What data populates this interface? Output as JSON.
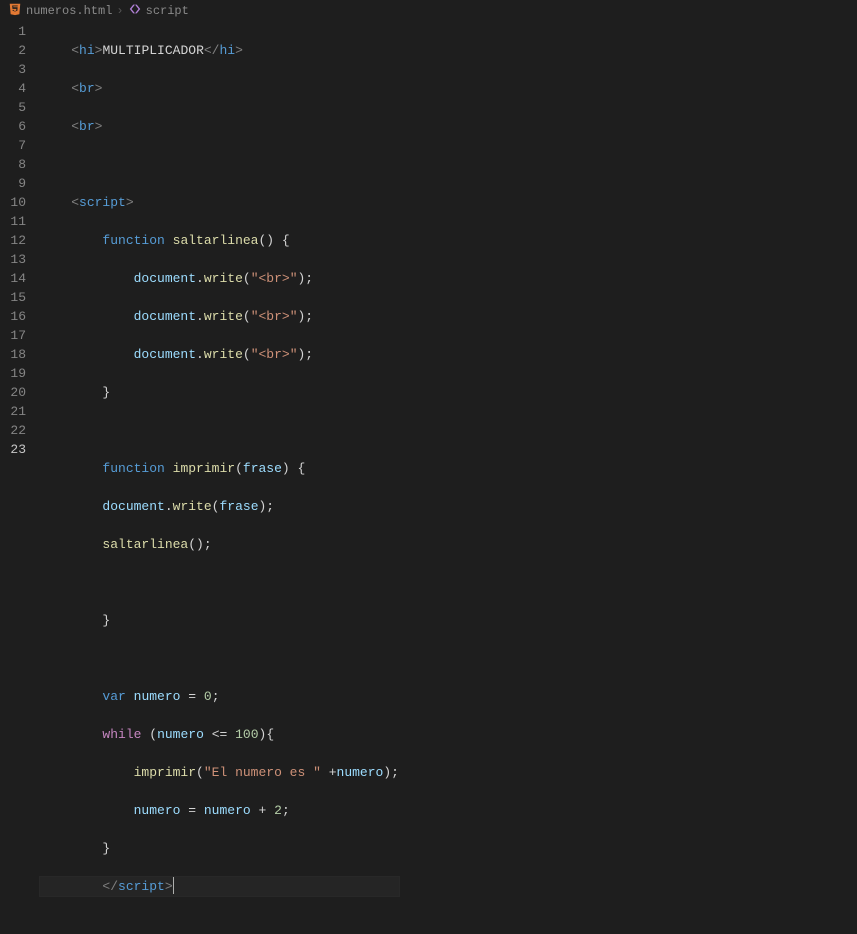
{
  "breadcrumb": {
    "file": "numeros.html",
    "symbol": "script"
  },
  "gutter": [
    "1",
    "2",
    "3",
    "4",
    "5",
    "6",
    "7",
    "8",
    "9",
    "10",
    "11",
    "12",
    "13",
    "14",
    "15",
    "16",
    "17",
    "18",
    "19",
    "20",
    "21",
    "22",
    "23"
  ],
  "code": {
    "l1": {
      "tag_open": "hi",
      "content": "MULTIPLICADOR",
      "tag_close": "hi"
    },
    "l2": {
      "tag": "br"
    },
    "l3": {
      "tag": "br"
    },
    "l5": {
      "tag": "script"
    },
    "l6": {
      "kw": "function",
      "name": "saltarlinea",
      "brace": "{"
    },
    "l7": {
      "obj": "document",
      "method": "write",
      "arg": "\"<br>\""
    },
    "l8": {
      "obj": "document",
      "method": "write",
      "arg": "\"<br>\""
    },
    "l9": {
      "obj": "document",
      "method": "write",
      "arg": "\"<br>\""
    },
    "l10": {
      "brace": "}"
    },
    "l12": {
      "kw": "function",
      "name": "imprimir",
      "param": "frase",
      "brace": "{"
    },
    "l13": {
      "obj": "document",
      "method": "write",
      "arg_ident": "frase"
    },
    "l14": {
      "call": "saltarlinea"
    },
    "l16": {
      "brace": "}"
    },
    "l18": {
      "kw": "var",
      "name": "numero",
      "eq": "=",
      "val": "0"
    },
    "l19": {
      "kw": "while",
      "ident": "numero",
      "op": "<=",
      "val": "100",
      "brace": "{"
    },
    "l20": {
      "call": "imprimir",
      "str": "\"El numero es \"",
      "plus": "+",
      "ident": "numero"
    },
    "l21": {
      "ident": "numero",
      "eq": "=",
      "ident2": "numero",
      "plus": "+",
      "val": "2"
    },
    "l22": {
      "brace": "}"
    },
    "l23": {
      "tag": "script"
    }
  }
}
